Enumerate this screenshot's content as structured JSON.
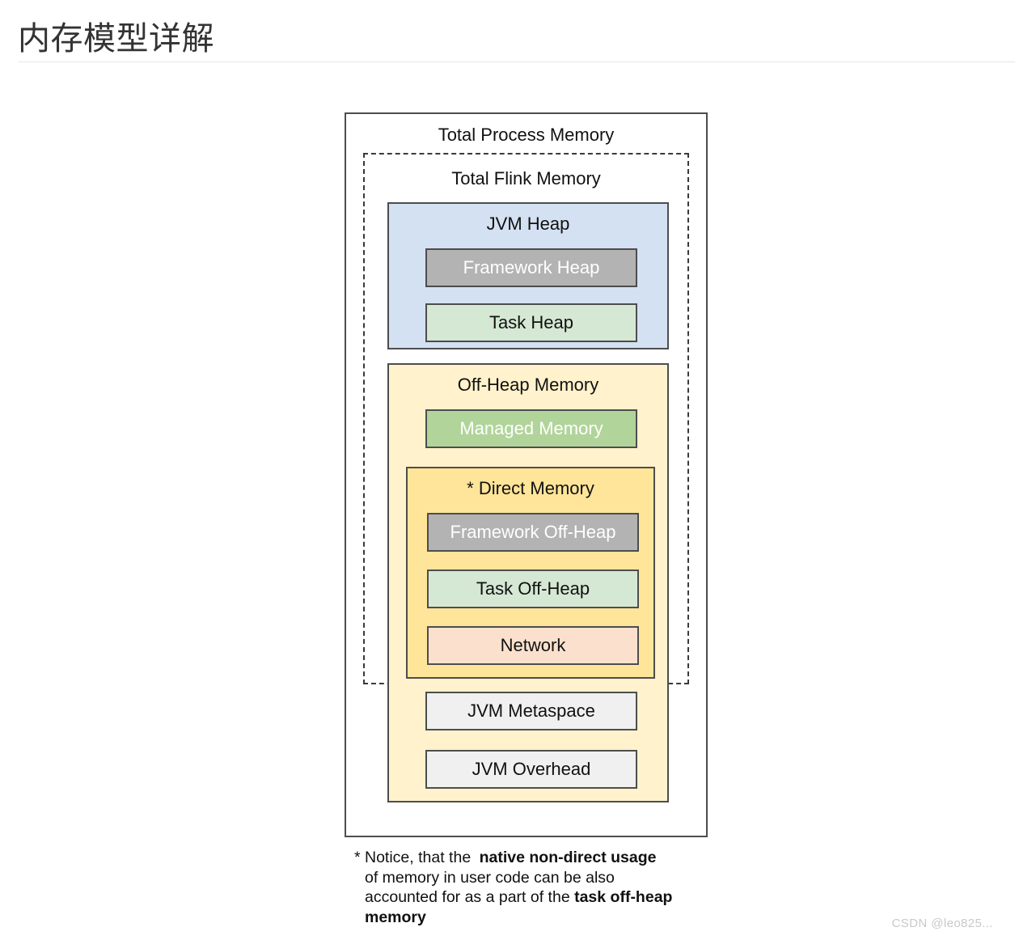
{
  "page": {
    "title": "内存模型详解",
    "watermark": "CSDN @leo825..."
  },
  "diagram": {
    "outer_label": "Total Process Memory",
    "flink_label": "Total Flink Memory",
    "jvm_heap": {
      "label": "JVM Heap",
      "children": [
        {
          "label": "Framework Heap",
          "style": "gray"
        },
        {
          "label": "Task Heap",
          "style": "green"
        }
      ]
    },
    "off_heap": {
      "label": "Off-Heap Memory",
      "managed": {
        "label": "Managed Memory",
        "style": "green-solid"
      },
      "direct": {
        "label": "* Direct Memory",
        "children": [
          {
            "label": "Framework Off-Heap",
            "style": "gray"
          },
          {
            "label": "Task Off-Heap",
            "style": "green"
          },
          {
            "label": "Network",
            "style": "peach"
          }
        ]
      },
      "jvm_metaspace": {
        "label": "JVM Metaspace",
        "style": "light"
      },
      "jvm_overhead": {
        "label": "JVM Overhead",
        "style": "light"
      }
    }
  },
  "footnote": {
    "line1_plain": "* Notice, that the ",
    "line1_bold": "native non-direct usage",
    "line2_plain": "of memory in user code can be also",
    "line3_plain": "accounted for as a part of the ",
    "line3_bold": "task off-heap",
    "line4_bold": "memory"
  },
  "colors": {
    "jvm_heap_bg": "#d4e1f2",
    "off_heap_bg": "#fff2cc",
    "direct_memory_bg": "#ffe599",
    "framework_gray": "#b3b3b3",
    "task_green": "#d5e8d4",
    "managed_green": "#b1d49a",
    "network_peach": "#fbe1cd",
    "jvm_light_gray": "#f0f0f0",
    "border": "#4d4d4d",
    "title_text": "#333333",
    "rule": "#e7e7e7",
    "watermark": "#c9c9c9"
  }
}
